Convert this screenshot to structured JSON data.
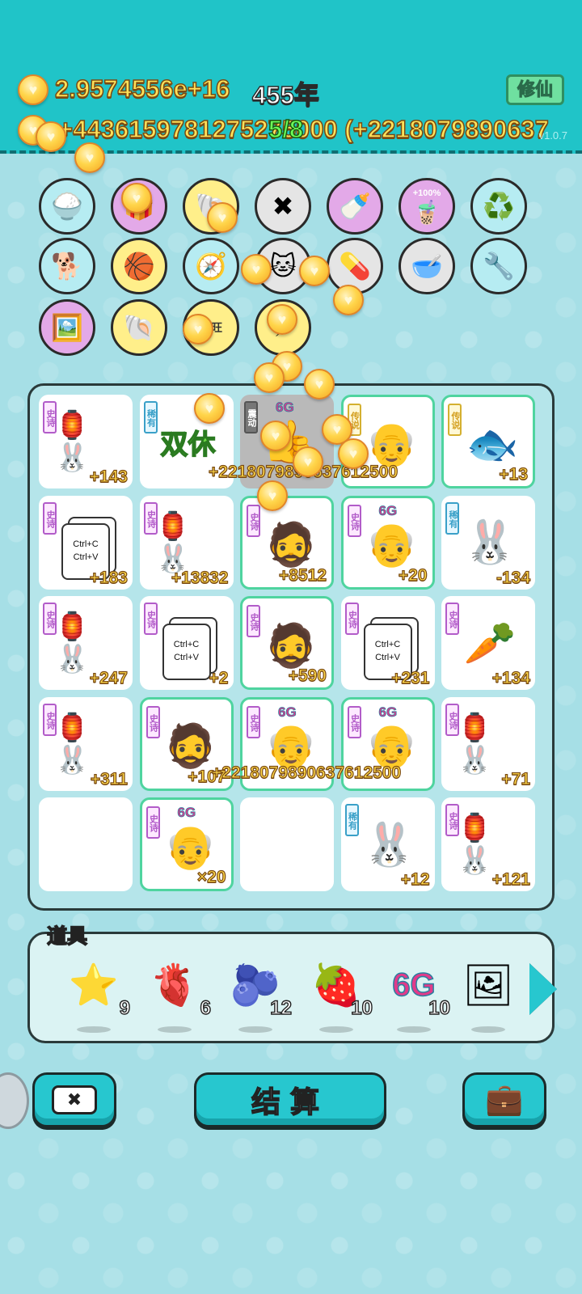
{
  "header": {
    "money": "2.9574556e+16",
    "year": "455年",
    "cultivate_label": "修仙",
    "income": "+4436159781275275000 (+2218079890637",
    "spin_count": "5/8",
    "version": "v1.0.7"
  },
  "items_row1": [
    "rice-bowl-icon",
    "gift-bag-icon",
    "seashell-icon",
    "remove-symbol-icon",
    "milk-pump-icon",
    "boba-cup-icon",
    "recycle-icon"
  ],
  "items_row2": [
    "sunglasses-dog-icon",
    "basketballs-icon",
    "compass-icon",
    "kitty-icon",
    "pill-pack-icon",
    "dog-bowl-icon",
    "tire-pump-icon"
  ],
  "items_row3": [
    "time-poster-icon",
    "scallop-icon",
    "wangwang-icon",
    "lightning-icon"
  ],
  "item_badges": {
    "boba": "+100%"
  },
  "board": {
    "rows": [
      [
        {
          "tag": "史诗",
          "tagType": "epic",
          "icon": "🏮🐰",
          "value": "+143"
        },
        {
          "tag": "稀有",
          "tagType": "rare",
          "icon": "双休",
          "value": ""
        },
        {
          "tag": "震动",
          "tagType": "shake",
          "icon": "👍",
          "value": "",
          "gray": true,
          "sixg": "6G"
        },
        {
          "tag": "传说",
          "tagType": "legend",
          "icon": "👴",
          "value": "",
          "legend": true
        },
        {
          "tag": "传说",
          "tagType": "legend",
          "icon": "🐟",
          "value": "+13",
          "legend": true
        }
      ],
      [
        {
          "tag": "史诗",
          "tagType": "epic",
          "icon": "copy",
          "value": "+183"
        },
        {
          "tag": "史诗",
          "tagType": "epic",
          "icon": "🏮🐰",
          "value": "+13832"
        },
        {
          "tag": "史诗",
          "tagType": "epic",
          "icon": "🧔",
          "value": "+8512",
          "legend": true
        },
        {
          "tag": "史诗",
          "tagType": "epic",
          "icon": "👴",
          "value": "+20",
          "legend": true,
          "sixg": "6G"
        },
        {
          "tag": "稀有",
          "tagType": "rare",
          "icon": "🐰",
          "value": "-134"
        }
      ],
      [
        {
          "tag": "史诗",
          "tagType": "epic",
          "icon": "🏮🐰",
          "value": "+247"
        },
        {
          "tag": "史诗",
          "tagType": "epic",
          "icon": "copy",
          "value": "+2"
        },
        {
          "tag": "史诗",
          "tagType": "epic",
          "icon": "🧔",
          "value": "+590",
          "legend": true
        },
        {
          "tag": "史诗",
          "tagType": "epic",
          "icon": "copy",
          "value": "+231"
        },
        {
          "tag": "史诗",
          "tagType": "epic",
          "icon": "🥕",
          "value": "+134"
        }
      ],
      [
        {
          "tag": "史诗",
          "tagType": "epic",
          "icon": "🏮🐰",
          "value": "+311"
        },
        {
          "tag": "史诗",
          "tagType": "epic",
          "icon": "🧔",
          "value": "+107",
          "legend": true
        },
        {
          "tag": "史诗",
          "tagType": "epic",
          "icon": "👴",
          "value": "",
          "legend": true,
          "sixg": "6G"
        },
        {
          "tag": "史诗",
          "tagType": "epic",
          "icon": "👴",
          "value": "",
          "legend": true,
          "sixg": "6G"
        },
        {
          "tag": "史诗",
          "tagType": "epic",
          "icon": "🏮🐰",
          "value": "+71"
        }
      ],
      [
        {
          "tag": "",
          "icon": "",
          "value": ""
        },
        {
          "tag": "史诗",
          "tagType": "epic",
          "icon": "👴",
          "value": "×20",
          "legend": true,
          "sixg": "6G"
        },
        {
          "tag": "",
          "icon": "",
          "value": ""
        },
        {
          "tag": "稀有",
          "tagType": "rare",
          "icon": "🐰",
          "value": "+12"
        },
        {
          "tag": "史诗",
          "tagType": "epic",
          "icon": "🏮🐰",
          "value": "+121"
        }
      ]
    ],
    "copy_text_1": "Ctrl+C",
    "copy_text_2": "Ctrl+V",
    "overlay_row1": "+2218079890637612500",
    "overlay_row4": "+2218079890637612500",
    "sixg_label": "6G"
  },
  "tools": {
    "label": "道具",
    "items": [
      {
        "name": "star",
        "icon": "⭐",
        "count": "9"
      },
      {
        "name": "liver",
        "icon": "🫀",
        "count": "6"
      },
      {
        "name": "blueberry",
        "icon": "🫐",
        "count": "12"
      },
      {
        "name": "lychee",
        "icon": "🍓",
        "count": "10"
      },
      {
        "name": "6g",
        "icon": "6G",
        "count": "10"
      },
      {
        "name": "portrait",
        "icon": "🖼",
        "count": ""
      }
    ]
  },
  "buttons": {
    "settle": "结算"
  }
}
